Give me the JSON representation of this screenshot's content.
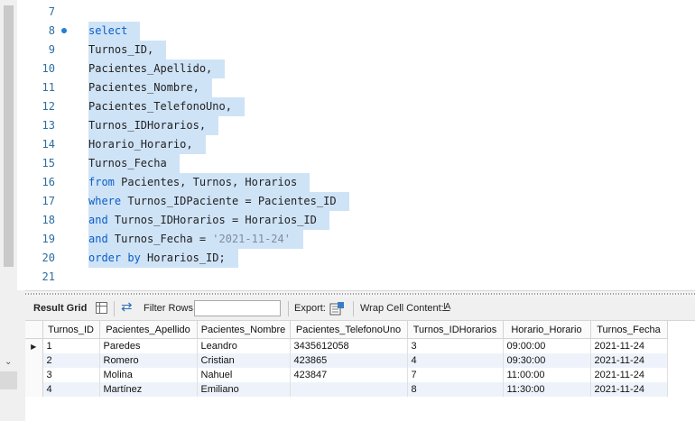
{
  "editor": {
    "lines": [
      {
        "num": "7",
        "tokens": [],
        "selected": false,
        "bullet": false
      },
      {
        "num": "8",
        "tokens": [
          {
            "t": "select",
            "k": "kw"
          }
        ],
        "selected": true,
        "bullet": true
      },
      {
        "num": "9",
        "tokens": [
          {
            "t": "Turnos_ID,",
            "k": ""
          }
        ],
        "selected": true,
        "bullet": false
      },
      {
        "num": "10",
        "tokens": [
          {
            "t": "Pacientes_Apellido,",
            "k": ""
          }
        ],
        "selected": true,
        "bullet": false
      },
      {
        "num": "11",
        "tokens": [
          {
            "t": "Pacientes_Nombre,",
            "k": ""
          }
        ],
        "selected": true,
        "bullet": false
      },
      {
        "num": "12",
        "tokens": [
          {
            "t": "Pacientes_TelefonoUno,",
            "k": ""
          }
        ],
        "selected": true,
        "bullet": false
      },
      {
        "num": "13",
        "tokens": [
          {
            "t": "Turnos_IDHorarios,",
            "k": ""
          }
        ],
        "selected": true,
        "bullet": false
      },
      {
        "num": "14",
        "tokens": [
          {
            "t": "Horario_Horario,",
            "k": ""
          }
        ],
        "selected": true,
        "bullet": false
      },
      {
        "num": "15",
        "tokens": [
          {
            "t": "Turnos_Fecha",
            "k": ""
          }
        ],
        "selected": true,
        "bullet": false
      },
      {
        "num": "16",
        "tokens": [
          {
            "t": "from",
            "k": "kw"
          },
          {
            "t": " Pacientes, Turnos, Horarios",
            "k": ""
          }
        ],
        "selected": true,
        "bullet": false
      },
      {
        "num": "17",
        "tokens": [
          {
            "t": "where",
            "k": "kw"
          },
          {
            "t": " Turnos_IDPaciente = Pacientes_ID",
            "k": ""
          }
        ],
        "selected": true,
        "bullet": false
      },
      {
        "num": "18",
        "tokens": [
          {
            "t": "and",
            "k": "kw"
          },
          {
            "t": " Turnos_IDHorarios = Horarios_ID",
            "k": ""
          }
        ],
        "selected": true,
        "bullet": false
      },
      {
        "num": "19",
        "tokens": [
          {
            "t": "and",
            "k": "kw"
          },
          {
            "t": " Turnos_Fecha = ",
            "k": ""
          },
          {
            "t": "'2021-11-24'",
            "k": "str"
          }
        ],
        "selected": true,
        "bullet": false
      },
      {
        "num": "20",
        "tokens": [
          {
            "t": "order by",
            "k": "kw"
          },
          {
            "t": " Horarios_ID;",
            "k": ""
          }
        ],
        "selected": true,
        "bullet": false
      },
      {
        "num": "21",
        "tokens": [],
        "selected": false,
        "bullet": false
      }
    ]
  },
  "toolbar": {
    "result_grid_label": "Result Grid",
    "filter_rows_label": "Filter Rows:",
    "filter_rows_value": "",
    "export_label": "Export:",
    "wrap_cell_label": "Wrap Cell Content:",
    "wrap_icon_glyph": "IA"
  },
  "result_grid": {
    "columns": [
      "Turnos_ID",
      "Pacientes_Apellido",
      "Pacientes_Nombre",
      "Pacientes_TelefonoUno",
      "Turnos_IDHorarios",
      "Horario_Horario",
      "Turnos_Fecha"
    ],
    "rows": [
      [
        "1",
        "Paredes",
        "Leandro",
        "3435612058",
        "3",
        "09:00:00",
        "2021-11-24"
      ],
      [
        "2",
        "Romero",
        "Cristian",
        "423865",
        "4",
        "09:30:00",
        "2021-11-24"
      ],
      [
        "3",
        "Molina",
        "Nahuel",
        "423847",
        "7",
        "11:00:00",
        "2021-11-24"
      ],
      [
        "4",
        "Martínez",
        "Emiliano",
        "",
        "8",
        "11:30:00",
        "2021-11-24"
      ]
    ],
    "current_row_marker": "▶"
  },
  "colors": {
    "keyword": "#0b5ec6",
    "selection": "#cfe3f7",
    "line_number": "#2b6e9f",
    "string": "#7d8d9c"
  }
}
